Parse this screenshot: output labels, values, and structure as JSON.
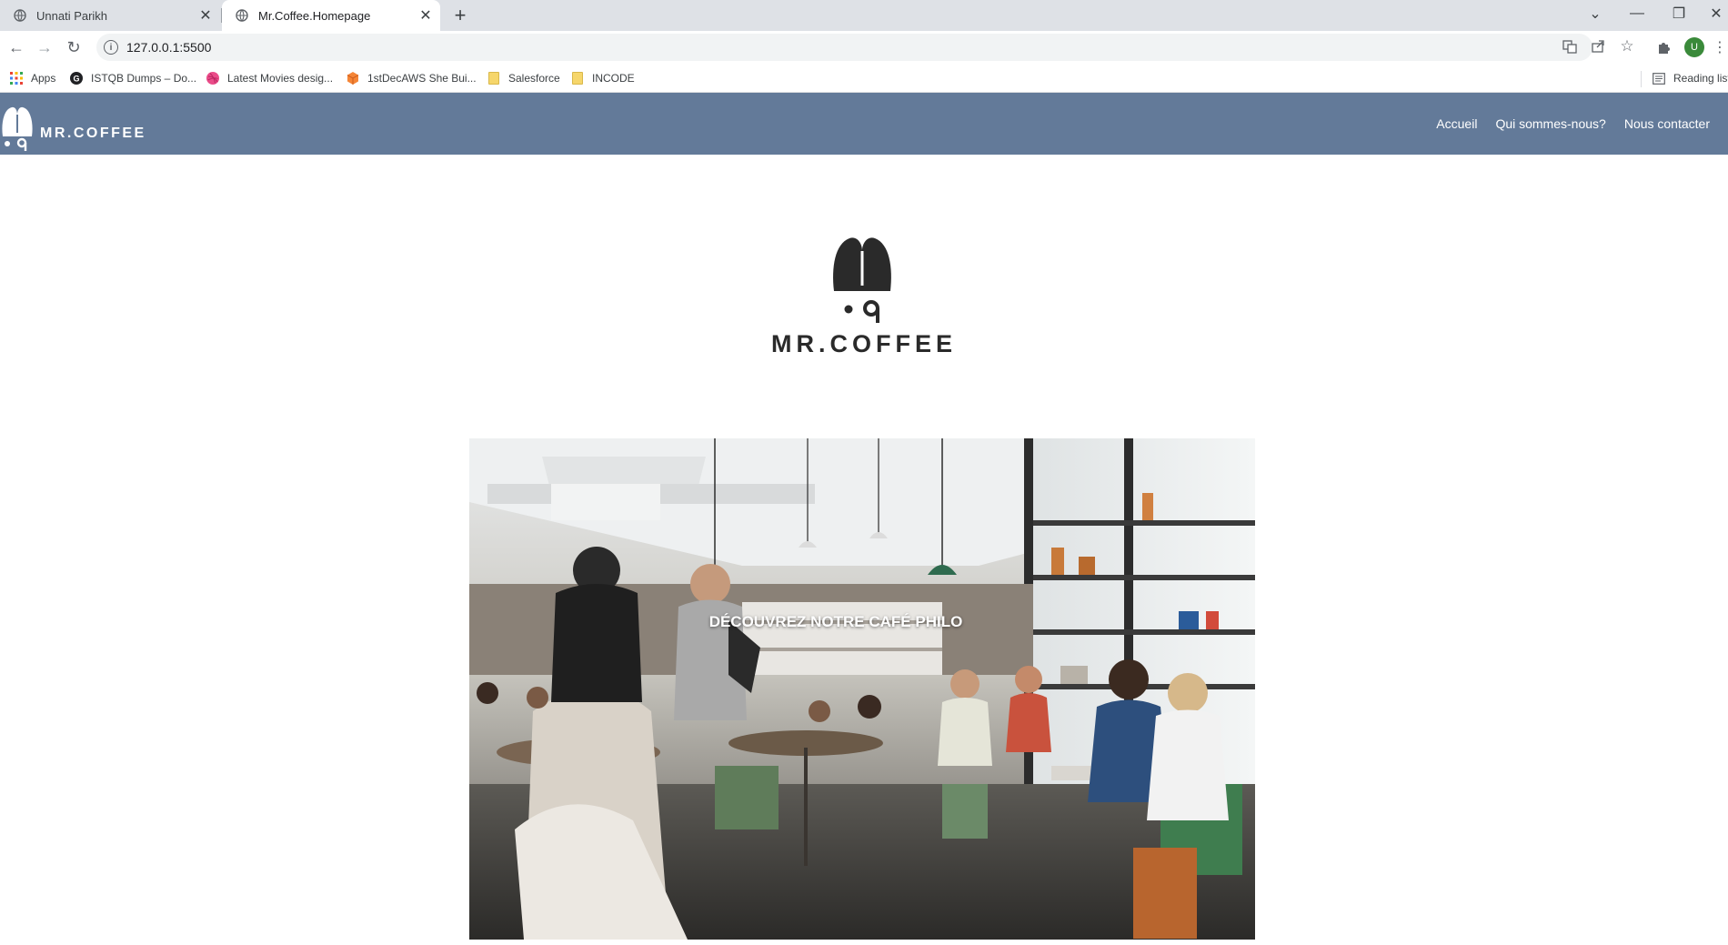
{
  "browser": {
    "tabs": [
      {
        "title": "Unnati Parikh",
        "active": false
      },
      {
        "title": "Mr.Coffee.Homepage",
        "active": true
      }
    ],
    "address": "127.0.0.1:5500",
    "profile_initial": "U",
    "bookmarks": [
      {
        "label": "Apps",
        "icon": "apps-grid-icon"
      },
      {
        "label": "ISTQB Dumps – Do...",
        "icon": "site-g-icon"
      },
      {
        "label": "Latest Movies desig...",
        "icon": "dribbble-icon"
      },
      {
        "label": "1stDecAWS She Bui...",
        "icon": "cube-icon"
      },
      {
        "label": "Salesforce",
        "icon": "folder-icon"
      },
      {
        "label": "INCODE",
        "icon": "folder-icon"
      }
    ],
    "reading_list": "Reading list"
  },
  "site": {
    "brand": "MR.COFFEE",
    "nav": [
      "Accueil",
      "Qui sommes-nous?",
      "Nous contacter"
    ],
    "hero_caption": "DÉCOUVREZ NOTRE CAFÉ PHILO",
    "colors": {
      "header": "#637a99",
      "logo_dark": "#2a2a2a"
    }
  }
}
